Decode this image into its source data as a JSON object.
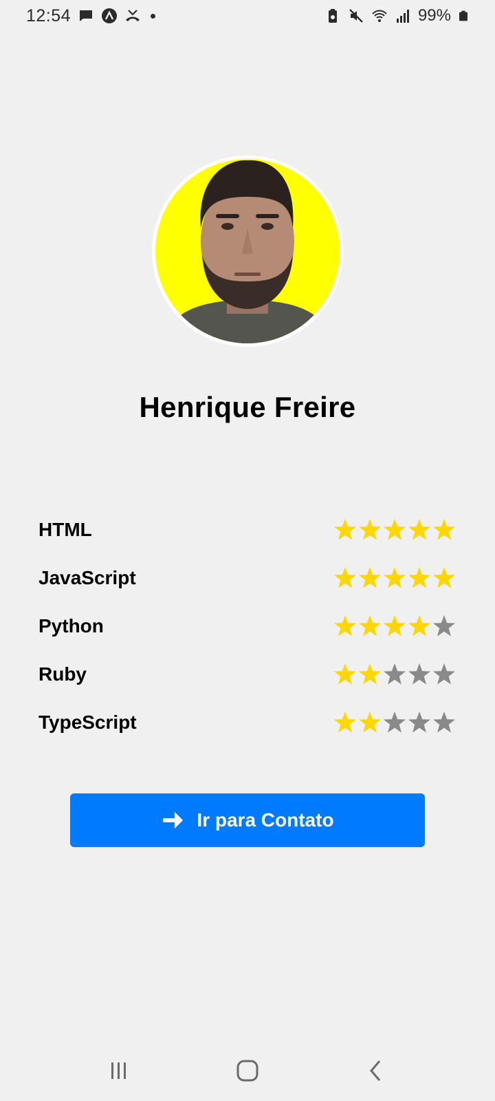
{
  "status_bar": {
    "time": "12:54",
    "battery_percent": "99%",
    "icons_left": [
      "message-icon",
      "app-a-icon",
      "missed-call-icon",
      "dot-icon"
    ],
    "icons_right": [
      "battery-saver-icon",
      "mute-icon",
      "wifi-icon",
      "signal-icon",
      "battery-icon"
    ]
  },
  "profile": {
    "name": "Henrique Freire",
    "avatar_background": "#ffff00"
  },
  "skills": [
    {
      "label": "HTML",
      "rating": 5
    },
    {
      "label": "JavaScript",
      "rating": 5
    },
    {
      "label": "Python",
      "rating": 4
    },
    {
      "label": "Ruby",
      "rating": 2
    },
    {
      "label": "TypeScript",
      "rating": 2
    }
  ],
  "rating_max": 5,
  "colors": {
    "star_filled": "#ffd700",
    "star_empty": "#8a8a8a",
    "button": "#007bff"
  },
  "contact_button": {
    "label": "Ir para Contato",
    "icon": "arrow-right-icon"
  },
  "nav_bar": {
    "items": [
      "recent-apps-icon",
      "home-icon",
      "back-icon"
    ]
  }
}
